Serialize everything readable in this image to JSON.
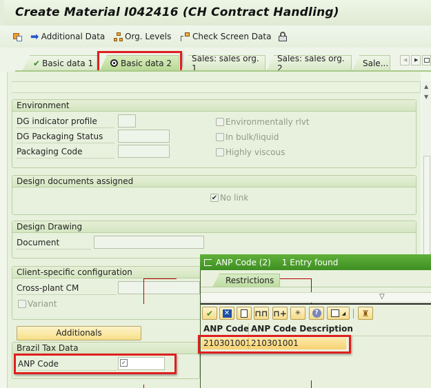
{
  "window": {
    "title": "Create Material I042416 (CH Contract Handling)"
  },
  "toolbar": {
    "items": [
      {
        "icon": "switch-view-icon",
        "label": ""
      },
      {
        "icon": "arrow-right-icon",
        "label": "Additional Data"
      },
      {
        "icon": "org-levels-icon",
        "label": "Org. Levels"
      },
      {
        "icon": "check-screen-icon",
        "label": "Check Screen Data"
      },
      {
        "icon": "lock-icon",
        "label": ""
      }
    ]
  },
  "tabs": [
    {
      "label": "Basic data 1",
      "icon": "check-icon",
      "active": false
    },
    {
      "label": "Basic data 2",
      "icon": "target-icon",
      "active": true
    },
    {
      "label": "Sales: sales org. 1",
      "active": false
    },
    {
      "label": "Sales: sales org. 2",
      "active": false
    },
    {
      "label": "Sale...",
      "active": false
    }
  ],
  "environment": {
    "title": "Environment",
    "fields": [
      {
        "label": "DG indicator profile",
        "value": ""
      },
      {
        "label": "DG Packaging Status",
        "value": ""
      },
      {
        "label": "Packaging Code",
        "value": ""
      }
    ],
    "checkboxes": [
      {
        "label": "Environmentally rlvt",
        "checked": false
      },
      {
        "label": "In bulk/liquid",
        "checked": false
      },
      {
        "label": "Highly viscous",
        "checked": false
      }
    ]
  },
  "design_docs": {
    "title": "Design documents assigned",
    "no_link": {
      "label": "No link",
      "checked": true
    }
  },
  "design_drawing": {
    "title": "Design Drawing",
    "document_label": "Document",
    "document_value": ""
  },
  "client_config": {
    "title": "Client-specific configuration",
    "cross_plant_label": "Cross-plant CM",
    "cross_plant_value": "",
    "variant": {
      "label": "Variant",
      "checked": false
    }
  },
  "additionals_button": "Additionals",
  "brazil_tax": {
    "title": "Brazil Tax Data",
    "anp_label": "ANP Code",
    "anp_value": ""
  },
  "popup": {
    "title": "ANP Code (2)",
    "entries_found": "1 Entry found",
    "restrictions_tab": "Restrictions",
    "toolbar_buttons": [
      "continue-icon",
      "cancel-icon",
      "new-document-icon",
      "find-icon",
      "find-next-icon",
      "select-icon",
      "help-icon",
      "print-icon",
      "settings-icon"
    ],
    "columns": [
      "ANP Code",
      "ANP Code Description"
    ],
    "rows": [
      [
        "210301001",
        "210301001"
      ]
    ]
  }
}
